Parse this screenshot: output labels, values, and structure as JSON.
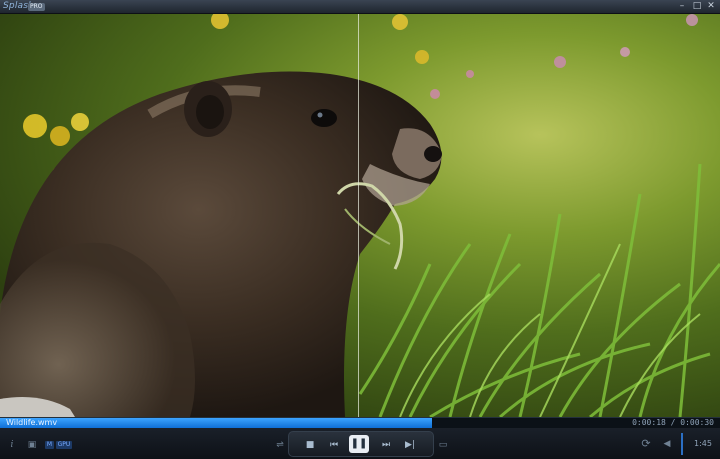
{
  "titlebar": {
    "logo": "Splash",
    "badge": "PRO",
    "minimize_icon": "–",
    "maximize_icon": "□",
    "close_icon": "✕"
  },
  "video": {
    "description_icon": "video-frame"
  },
  "seekbar": {
    "filename": "Wildlife.wmv",
    "timecode": "0:00:18 / 0:00:30",
    "progress": 0.6
  },
  "controls": {
    "info_icon": "i",
    "capture_icon": "▣",
    "m_badge": "M",
    "gpu_badge": "GPU",
    "eq_icon": "⇌",
    "stop_icon": "■",
    "prev_icon": "⏮",
    "pause_icon": "❚❚",
    "next_icon": "⏭",
    "frame_icon": "▶|",
    "open_icon": "▭",
    "repeat_icon": "⟳",
    "volume_icon": "◀",
    "clock": "1:45"
  }
}
